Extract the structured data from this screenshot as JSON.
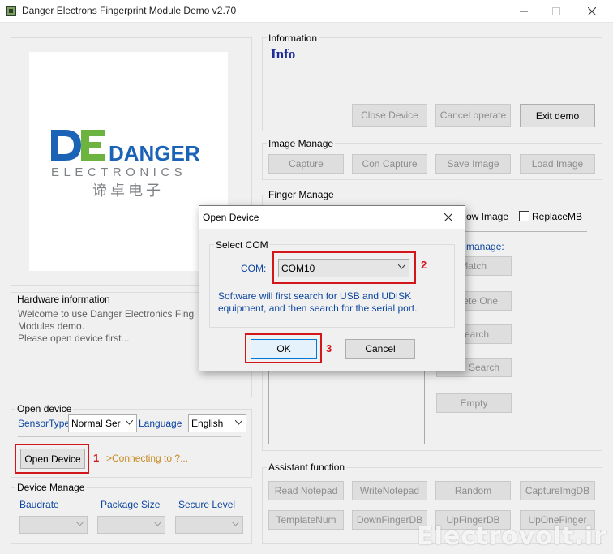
{
  "window": {
    "title": "Danger Electrons Fingerprint Module Demo v2.70",
    "minimize_icon": "minimize-icon",
    "maximize_icon": "maximize-icon",
    "close_icon": "close-icon"
  },
  "logo": {
    "letters": "DE",
    "brand_top": "DANGER",
    "brand_bottom": "ELECTRONICS",
    "chinese": "谛卓电子",
    "colors": {
      "blue": "#1a63b6",
      "green": "#6db33f",
      "gray": "#7f8285"
    }
  },
  "information": {
    "title": "Information",
    "info_text": "Info",
    "close_device": "Close Device",
    "cancel_operate": "Cancel operate",
    "exit_demo": "Exit demo"
  },
  "image_manage": {
    "title": "Image Manage",
    "capture": "Capture",
    "con_capture": "Con Capture",
    "save_image": "Save Image",
    "load_image": "Load Image"
  },
  "finger_manage": {
    "title": "Finger Manage",
    "show_image_partial": "ow Image",
    "replace_mb": "ReplaceMB",
    "manage_label_partial": "manage:",
    "match_partial": "Match",
    "delete_one_partial": "ete One",
    "search_partial": "earch",
    "h_search_partial": "Search",
    "empty": "Empty"
  },
  "hardware": {
    "title": "Hardware information",
    "lines": [
      "Welcome to use Danger Electronics Fing",
      "Modules demo.",
      "Please open device first..."
    ]
  },
  "open_device_group": {
    "title": "Open device",
    "sensor_type_label": "SensorType",
    "sensor_type_value": "Normal Ser",
    "language_label": "Language",
    "language_value": "English",
    "open_button": "Open Device",
    "status": ">Connecting to ?..."
  },
  "device_manage": {
    "title": "Device Manage",
    "baudrate": "Baudrate",
    "package_size": "Package Size",
    "secure_level": "Secure Level"
  },
  "assistant": {
    "title": "Assistant function",
    "buttons_row1": [
      "Read Notepad",
      "WriteNotepad",
      "Random",
      "CaptureImgDB"
    ],
    "buttons_row2": [
      "TemplateNum",
      "DownFingerDB",
      "UpFingerDB",
      "UpOneFinger"
    ]
  },
  "dialog": {
    "title": "Open Device",
    "group_title": "Select COM",
    "com_label": "COM:",
    "com_value": "COM10",
    "info_line1": "Software will first search for USB and UDISK",
    "info_line2": "equipment, and then search for the serial port.",
    "ok": "OK",
    "cancel": "Cancel"
  },
  "annotations": {
    "one": "1",
    "two": "2",
    "three": "3",
    "color": "#d3161c"
  },
  "watermark": "Electrovolt.ir"
}
